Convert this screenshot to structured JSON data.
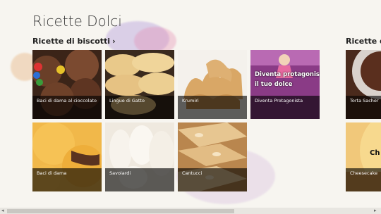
{
  "app": {
    "title": "Ricette Dolci"
  },
  "groups": [
    {
      "header": "Ricette di biscotti",
      "tiles": [
        {
          "caption": "Baci di dama al cioccolato"
        },
        {
          "caption": "Lingue di Gatto"
        },
        {
          "caption": "Krumiri"
        },
        {
          "caption": "Diventa Protagonista",
          "promo_line1": "Diventa protagonista",
          "promo_line2": "il tuo dolce"
        },
        {
          "caption": "Baci di dama"
        },
        {
          "caption": "Savoiardi"
        },
        {
          "caption": "Cantucci"
        }
      ]
    },
    {
      "header": "Ricette del",
      "tiles": [
        {
          "caption": "Torta Sacher"
        },
        {
          "caption": "Cheesecake",
          "promo_text": "Ch"
        }
      ]
    }
  ],
  "scrollbar": {
    "left_arrow": "◂",
    "right_arrow": "▸"
  },
  "colors": {
    "caption_overlay": "#000000",
    "promo_purple": "#9c3b9a",
    "background": "#f7f5f0"
  }
}
